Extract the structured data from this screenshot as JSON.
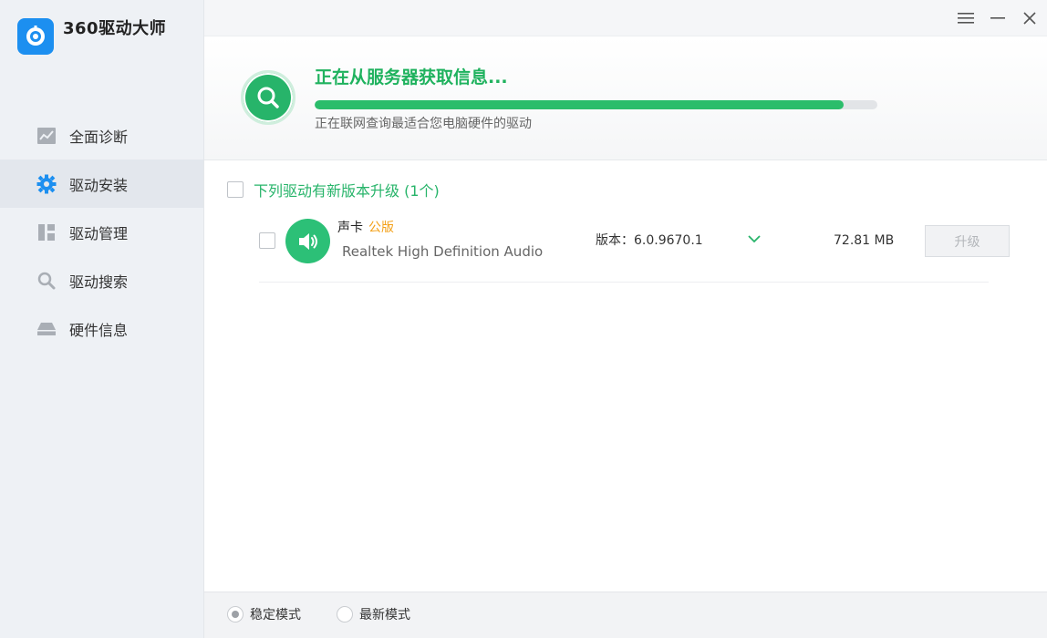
{
  "app": {
    "title": "360驱动大师",
    "brand_color": "#1c8ff0",
    "accent_color": "#27b46a"
  },
  "sidebar": {
    "items": [
      {
        "label": "全面诊断",
        "icon": "chart-icon",
        "active": false
      },
      {
        "label": "驱动安装",
        "icon": "gear-icon",
        "active": true
      },
      {
        "label": "驱动管理",
        "icon": "grid-icon",
        "active": false
      },
      {
        "label": "驱动搜索",
        "icon": "search-icon",
        "active": false
      },
      {
        "label": "硬件信息",
        "icon": "drive-icon",
        "active": false
      }
    ]
  },
  "titlebar": {
    "buttons": [
      "menu-icon",
      "minimize-icon",
      "close-icon"
    ]
  },
  "status": {
    "title": "正在从服务器获取信息...",
    "subtitle": "正在联网查询最适合您电脑硬件的驱动",
    "progress": 0.94
  },
  "list": {
    "group_label": "下列驱动有新版本升级 (1个)",
    "drivers": [
      {
        "name": "声卡",
        "tag": "公版",
        "description": "Realtek High Definition Audio",
        "version": "版本：6.0.9670.1",
        "size": "72.81 MB",
        "action": "升级",
        "icon": "speaker-icon"
      }
    ]
  },
  "footer": {
    "modes": [
      {
        "label": "稳定模式",
        "selected": true
      },
      {
        "label": "最新模式",
        "selected": false
      }
    ]
  }
}
